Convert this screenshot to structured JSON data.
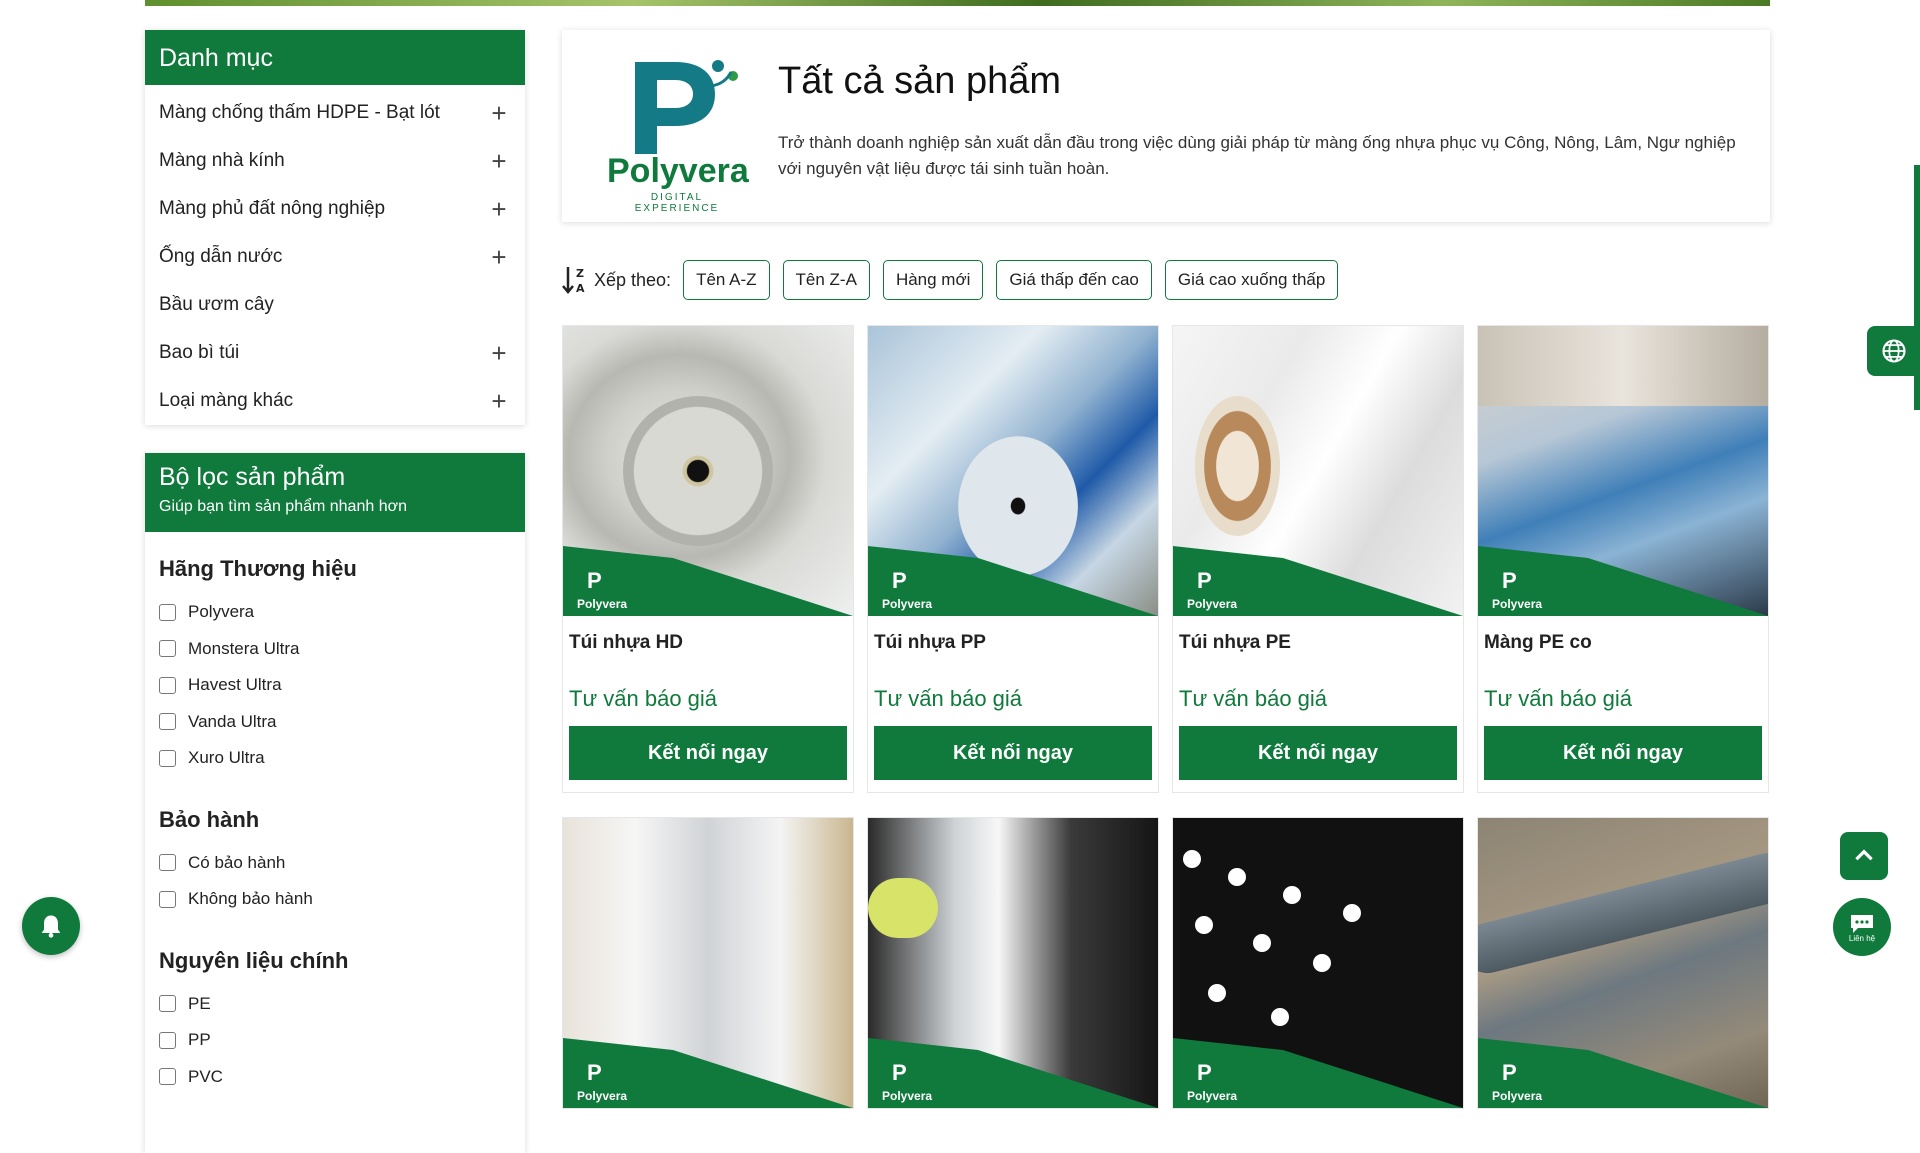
{
  "categories": {
    "title": "Danh mục",
    "items": [
      {
        "label": "Màng chống thấm HDPE - Bạt lót",
        "expand": "+"
      },
      {
        "label": "Màng nhà kính",
        "expand": "+"
      },
      {
        "label": "Màng phủ đất nông nghiệp",
        "expand": "+"
      },
      {
        "label": "Ống dẫn nước",
        "expand": "+"
      },
      {
        "label": "Bầu ươm cây",
        "expand": ""
      },
      {
        "label": "Bao bì túi",
        "expand": "+"
      },
      {
        "label": "Loại màng khác",
        "expand": "+"
      }
    ]
  },
  "filter": {
    "title": "Bộ lọc sản phẩm",
    "subtitle": "Giúp bạn tìm sản phẩm nhanh hơn",
    "groups": [
      {
        "title": "Hãng Thương hiệu",
        "options": [
          "Polyvera",
          "Monstera Ultra",
          "Havest Ultra",
          "Vanda Ultra",
          "Xuro Ultra"
        ]
      },
      {
        "title": "Bảo hành",
        "options": [
          "Có bảo hành",
          "Không bảo hành"
        ]
      },
      {
        "title": "Nguyên liệu chính",
        "options": [
          "PE",
          "PP",
          "PVC"
        ]
      }
    ]
  },
  "banner": {
    "brand": "Polyvera",
    "tagline": "DIGITAL EXPERIENCE",
    "title": "Tất cả sản phẩm",
    "description": "Trở thành doanh nghiệp sản xuất dẫn đầu trong việc dùng giải pháp từ màng ống nhựa phục vụ Công, Nông, Lâm, Ngư nghiệp với nguyên vật liệu được tái sinh tuần hoàn."
  },
  "sort": {
    "label": "Xếp theo:",
    "options": [
      "Tên A-Z",
      "Tên Z-A",
      "Hàng mới",
      "Giá thấp đến cao",
      "Giá cao xuống thấp"
    ]
  },
  "products": [
    {
      "name": "Túi nhựa HD",
      "price": "Tư vấn báo giá",
      "cta": "Kết nối ngay"
    },
    {
      "name": "Túi nhựa PP",
      "price": "Tư vấn báo giá",
      "cta": "Kết nối ngay"
    },
    {
      "name": "Túi nhựa PE",
      "price": "Tư vấn báo giá",
      "cta": "Kết nối ngay"
    },
    {
      "name": "Màng PE co",
      "price": "Tư vấn báo giá",
      "cta": "Kết nối ngay"
    }
  ],
  "badge_brand": "Polyvera",
  "chat_label": "Liên hệ",
  "colors": {
    "brand_green": "#0f7a3c",
    "text_dark": "#222222"
  },
  "icons": [
    "plus-icon",
    "sort-icon",
    "bell-icon",
    "arrow-up-icon",
    "chat-icon",
    "globe-icon"
  ]
}
